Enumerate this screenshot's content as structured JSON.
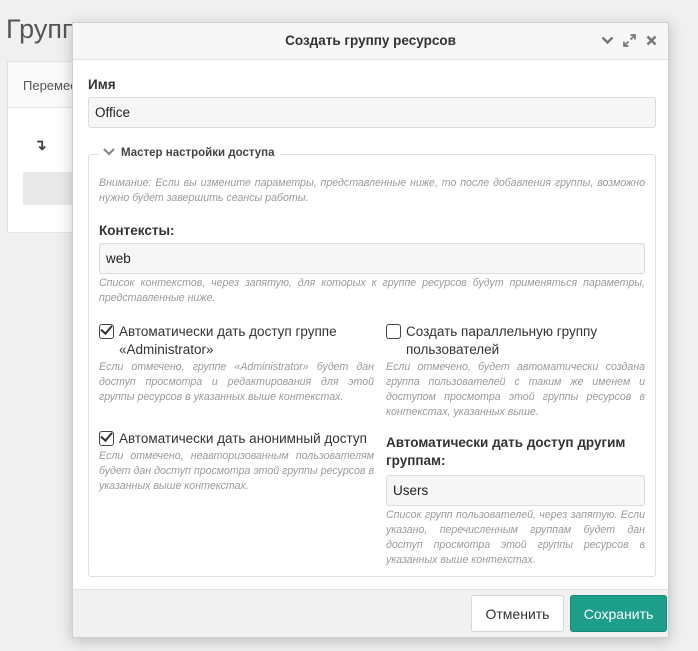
{
  "background": {
    "page_title": "Групп",
    "panel_header": "Перемес",
    "row_icon": "↴"
  },
  "dialog": {
    "title": "Создать группу ресурсов",
    "tools": [
      "chevron-down-icon",
      "expand-icon",
      "close-icon"
    ],
    "name_label": "Имя",
    "name_value": "Office",
    "access_wizard": {
      "legend": "Мастер настройки доступа",
      "warning": "Внимание: Если вы измените параметры, представленные ниже, то после добавления группы, возможно нужно будет завершить сеансы работы.",
      "contexts_label": "Контексты:",
      "contexts_value": "web",
      "contexts_help": "Список контекстов, через запятую, для которых к группе ресурсов будут применяться параметры, представленные ниже.",
      "admin_access_label": "Автоматически дать доступ группе «Administrator»",
      "admin_access_checked": true,
      "admin_access_help": "Если отмечено, группе «Administrator» будет дан доступ просмотра и редактирования для этой группы ресурсов в указанных выше контекстах.",
      "anon_access_label": "Автоматически дать анонимный доступ",
      "anon_access_checked": true,
      "anon_access_help": "Если отмечено, неавторизованным пользователям будет дан доступ просмотра этой группы ресурсов в указанных выше контекстах.",
      "parallel_group_label": "Создать параллельную группу пользователей",
      "parallel_group_checked": false,
      "parallel_group_help": "Если отмечено, будет автоматически создана группа пользователей с таким же именем и доступом просмотра этой группы ресурсов в контекстах, указанных выше.",
      "other_groups_label": "Автоматически дать доступ другим группам:",
      "other_groups_value": "Users",
      "other_groups_help": "Список групп пользователей, через запятую. Если указано, перечисленным группам будет дан доступ просмотра этой группы ресурсов в указанных выше контекстах."
    },
    "cancel_label": "Отменить",
    "save_label": "Сохранить"
  },
  "colors": {
    "save_button": "#1d9e8a",
    "background": "#f0f0f0"
  }
}
